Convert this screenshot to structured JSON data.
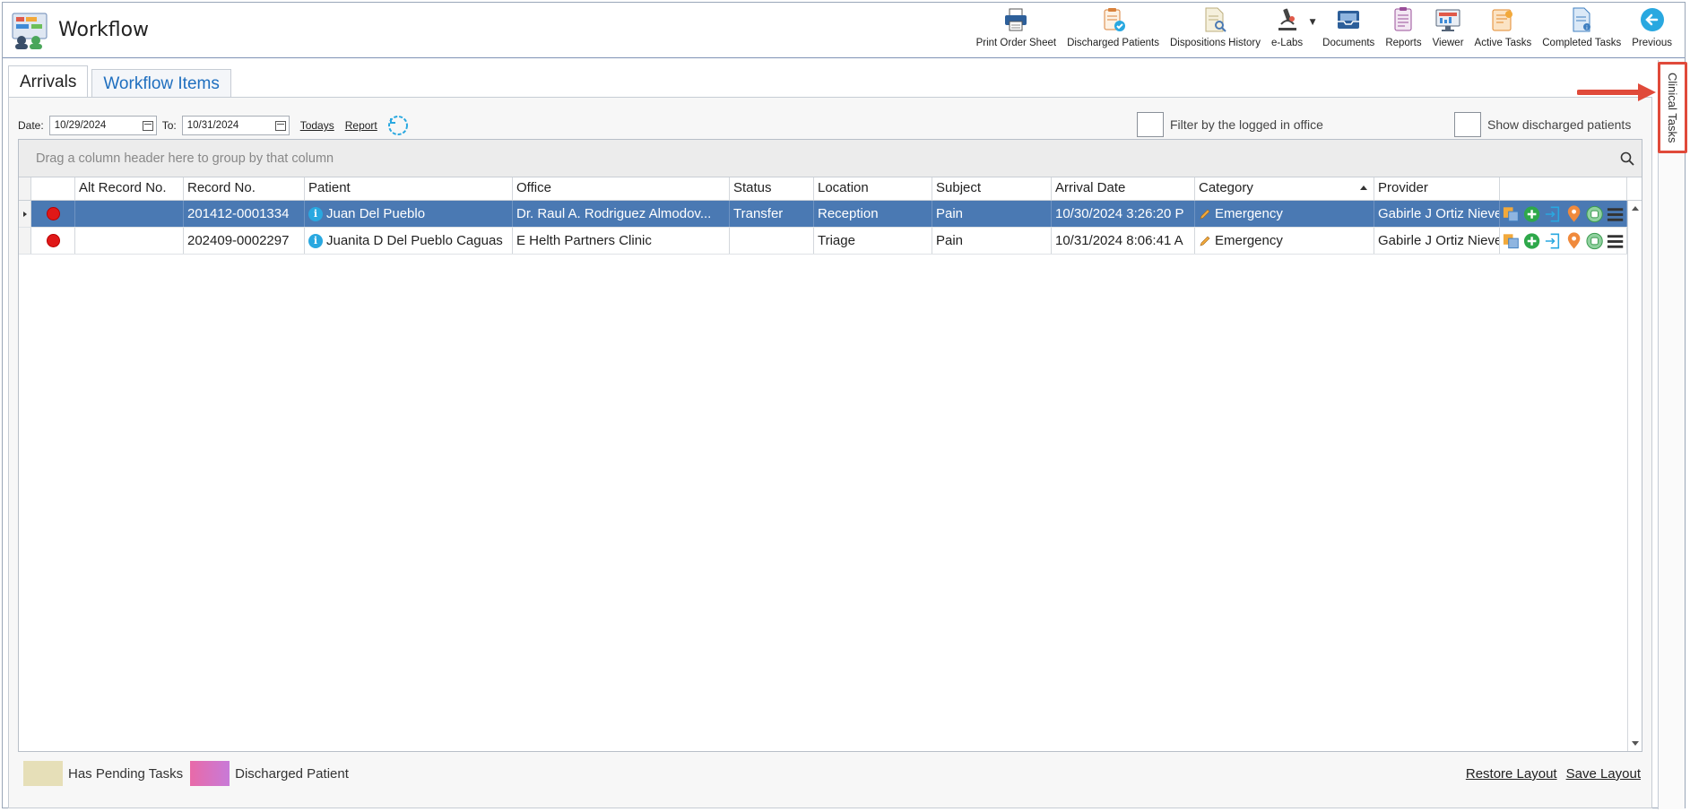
{
  "app": {
    "title": "Workflow"
  },
  "toolbar": [
    {
      "label": "Print Order Sheet",
      "icon": "printer-icon"
    },
    {
      "label": "Discharged Patients",
      "icon": "clipboard-check-icon"
    },
    {
      "label": "Dispositions History",
      "icon": "document-search-icon"
    },
    {
      "label": "e-Labs",
      "icon": "microscope-icon"
    },
    {
      "label": "Documents",
      "icon": "inbox-tray-icon"
    },
    {
      "label": "Reports",
      "icon": "report-clipboard-icon"
    },
    {
      "label": "Viewer",
      "icon": "monitor-chart-icon"
    },
    {
      "label": "Active Tasks",
      "icon": "active-tasks-icon"
    },
    {
      "label": "Completed Tasks",
      "icon": "completed-tasks-icon"
    },
    {
      "label": "Previous",
      "icon": "back-arrow-icon"
    }
  ],
  "side_tab": {
    "label": "Clinical Tasks"
  },
  "tabs": [
    {
      "label": "Arrivals",
      "active": false
    },
    {
      "label": "Workflow Items",
      "active": true
    }
  ],
  "filters": {
    "date_label": "Date:",
    "date_from": "10/29/2024",
    "to_label": "To:",
    "date_to": "10/31/2024",
    "todays_link": "Todays",
    "report_link": "Report",
    "filter_office_label": "Filter by the logged in office",
    "show_discharged_label": "Show discharged patients"
  },
  "grid": {
    "group_panel_text": "Drag a column header here to group by that column",
    "columns": [
      "",
      "Alt Record No.",
      "Record No.",
      "Patient",
      "Office",
      "Status",
      "Location",
      "Subject",
      "Arrival Date",
      "Category",
      "Provider",
      ""
    ],
    "rows": [
      {
        "alt_record": "",
        "record": "201412-0001334",
        "patient": "Juan Del Pueblo",
        "office": "Dr. Raul A. Rodriguez Almodov...",
        "status": "Transfer",
        "location": "Reception",
        "subject": "Pain",
        "arrival": "10/30/2024 3:26:20 P",
        "category": "Emergency",
        "provider": "Gabirle J Ortiz Nieve",
        "selected": true
      },
      {
        "alt_record": "",
        "record": "202409-0002297",
        "patient": "Juanita D Del Pueblo Caguas",
        "office": "E Helth Partners Clinic",
        "status": "",
        "location": "Triage",
        "subject": "Pain",
        "arrival": "10/31/2024 8:06:41 A",
        "category": "Emergency",
        "provider": "Gabirle J Ortiz Nieve",
        "selected": false
      }
    ]
  },
  "legend": [
    {
      "label": "Has Pending Tasks",
      "color": "#e6dfb8"
    },
    {
      "label": "Discharged Patient",
      "color": "#e86aa8"
    }
  ],
  "footer": {
    "restore": "Restore Layout",
    "save": "Save Layout"
  },
  "colors": {
    "selected_row": "#4a79b3",
    "accent": "#1f6fbf",
    "status_dot": "#e01818",
    "highlight": "#e04a3a"
  }
}
